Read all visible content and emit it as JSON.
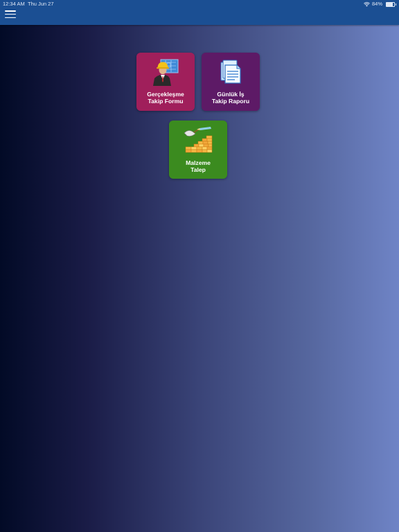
{
  "status_bar": {
    "time": "12:34 AM",
    "date": "Thu Jun 27",
    "battery": "84%",
    "battery_level": 0.84
  },
  "header": {
    "menu_icon": "hamburger-menu-icon",
    "color": "#1b4f93"
  },
  "tiles": [
    {
      "label": "Gerçekleşme\nTakip Formu",
      "icon": "engineer-with-blueprint-icon",
      "color": "#a01f5b"
    },
    {
      "label": "Günlük İş\nTakip Raporu",
      "icon": "documents-icon",
      "color": "#5d1a66"
    },
    {
      "label": "Malzeme\nTalep",
      "icon": "bricks-and-trowel-icon",
      "color": "#3b8b1f"
    }
  ]
}
